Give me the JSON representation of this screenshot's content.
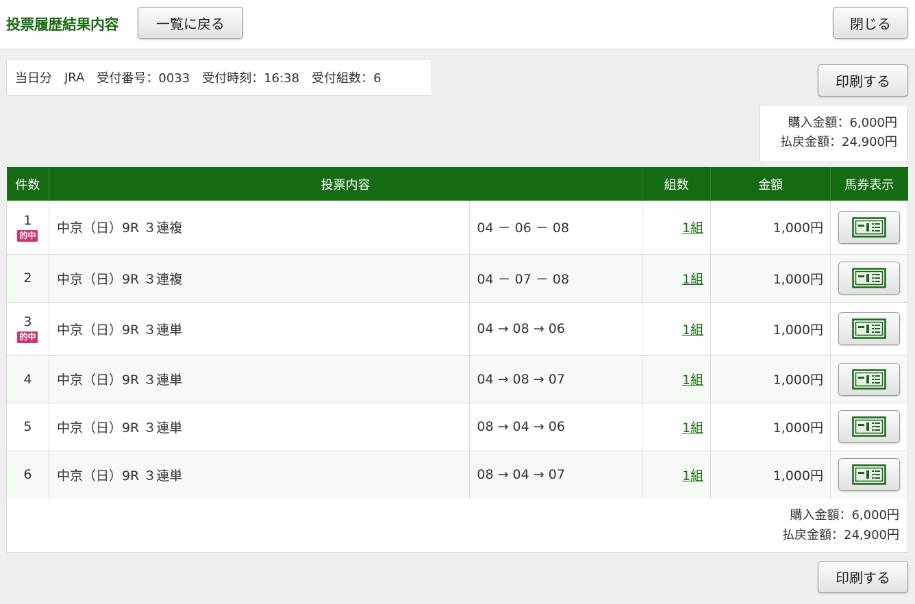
{
  "header": {
    "title": "投票履歴結果内容",
    "back_label": "一覧に戻る",
    "close_label": "閉じる"
  },
  "info": {
    "day": "当日分",
    "org": "JRA",
    "receipt_no": "受付番号：0033",
    "receipt_time": "受付時刻：16:38",
    "receipt_count": "受付組数：6"
  },
  "print_label": "印刷する",
  "summary": {
    "purchase": "購入金額：6,000円",
    "payout": "払戻金額：24,900円"
  },
  "table": {
    "headers": {
      "count": "件数",
      "content": "投票内容",
      "kumi": "組数",
      "amount": "金額",
      "ticket": "馬券表示"
    },
    "rows": [
      {
        "no": "1",
        "hit": "的中",
        "race": "中京（日）9R ３連複",
        "combo": "04 － 06 － 08",
        "kumi": "1組",
        "amount": "1,000円"
      },
      {
        "no": "2",
        "hit": "",
        "race": "中京（日）9R ３連複",
        "combo": "04 － 07 － 08",
        "kumi": "1組",
        "amount": "1,000円"
      },
      {
        "no": "3",
        "hit": "的中",
        "race": "中京（日）9R ３連単",
        "combo": "04 → 08 → 06",
        "kumi": "1組",
        "amount": "1,000円"
      },
      {
        "no": "4",
        "hit": "",
        "race": "中京（日）9R ３連単",
        "combo": "04 → 08 → 07",
        "kumi": "1組",
        "amount": "1,000円"
      },
      {
        "no": "5",
        "hit": "",
        "race": "中京（日）9R ３連単",
        "combo": "08 → 04 → 06",
        "kumi": "1組",
        "amount": "1,000円"
      },
      {
        "no": "6",
        "hit": "",
        "race": "中京（日）9R ３連単",
        "combo": "08 → 04 → 07",
        "kumi": "1組",
        "amount": "1,000円"
      }
    ]
  },
  "colors": {
    "brand_green": "#146b12",
    "hit_badge": "#d6336c"
  },
  "icons": {
    "ticket": "ticket-icon"
  }
}
